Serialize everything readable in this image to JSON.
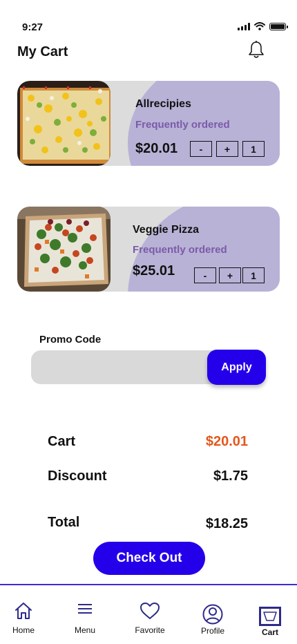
{
  "status_bar": {
    "time": "9:27"
  },
  "header": {
    "title": "My Cart"
  },
  "cart_items": [
    {
      "name": "Allrecipies",
      "tag": "Frequently ordered",
      "price": "$20.01",
      "minus": "-",
      "plus": "+",
      "quantity": "1"
    },
    {
      "name": "Veggie Pizza",
      "tag": "Frequently ordered",
      "price": "$25.01",
      "minus": "-",
      "plus": "+",
      "quantity": "1"
    }
  ],
  "promo": {
    "label": "Promo Code",
    "value": "",
    "apply_label": "Apply"
  },
  "summary": {
    "cart_label": "Cart",
    "cart_value": "$20.01",
    "discount_label": "Discount",
    "discount_value": "$1.75",
    "total_label": "Total",
    "total_value": "$18.25"
  },
  "checkout_label": "Check Out",
  "bottom_nav": [
    {
      "label": "Home",
      "icon": "home-icon"
    },
    {
      "label": "Menu",
      "icon": "menu-icon"
    },
    {
      "label": "Favorite",
      "icon": "heart-icon"
    },
    {
      "label": "Profile",
      "icon": "profile-icon"
    },
    {
      "label": "Cart",
      "icon": "cart-icon",
      "active": true
    }
  ],
  "colors": {
    "accent": "#2400ea",
    "card_bg": "#dcdcdc",
    "card_blob": "#b8b2d6",
    "tag_text": "#7a5aa8",
    "cart_value": "#e5561b",
    "nav_icon": "#2d2a8a"
  }
}
